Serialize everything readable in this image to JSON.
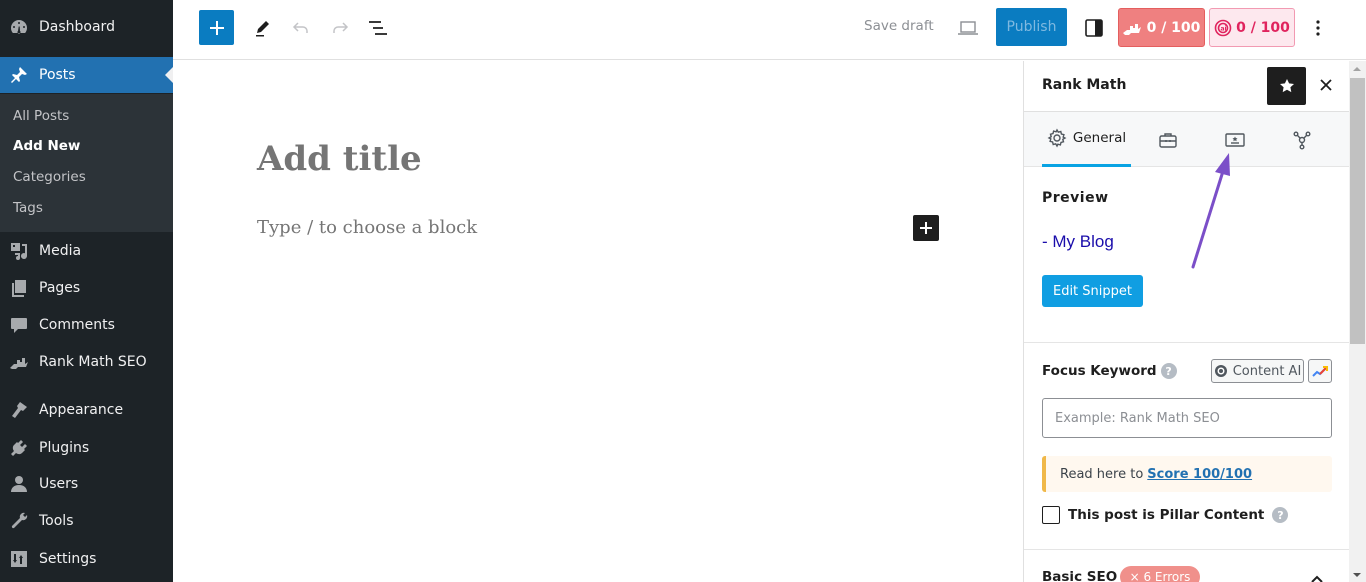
{
  "sidebar": {
    "items": [
      {
        "id": "dashboard",
        "label": "Dashboard",
        "icon": "dashboard-icon"
      },
      {
        "id": "posts",
        "label": "Posts",
        "icon": "pin-icon",
        "active": true
      },
      {
        "id": "media",
        "label": "Media",
        "icon": "media-icon"
      },
      {
        "id": "pages",
        "label": "Pages",
        "icon": "pages-icon"
      },
      {
        "id": "comments",
        "label": "Comments",
        "icon": "comment-icon"
      },
      {
        "id": "rank-math-seo",
        "label": "Rank Math SEO",
        "icon": "rank-math-icon"
      },
      {
        "id": "appearance",
        "label": "Appearance",
        "icon": "brush-icon"
      },
      {
        "id": "plugins",
        "label": "Plugins",
        "icon": "plug-icon"
      },
      {
        "id": "users",
        "label": "Users",
        "icon": "user-icon"
      },
      {
        "id": "tools",
        "label": "Tools",
        "icon": "wrench-icon"
      },
      {
        "id": "settings",
        "label": "Settings",
        "icon": "settings-icon"
      }
    ],
    "submenu": [
      {
        "label": "All Posts"
      },
      {
        "label": "Add New",
        "current": true
      },
      {
        "label": "Categories"
      },
      {
        "label": "Tags"
      }
    ]
  },
  "toolbar": {
    "save_draft": "Save draft",
    "publish": "Publish",
    "seo_score": "0 / 100",
    "content_ai_score": "0 / 100"
  },
  "editor": {
    "title_placeholder": "Add title",
    "block_placeholder": "Type / to choose a block"
  },
  "panel": {
    "title": "Rank Math",
    "tabs": [
      {
        "label": "General",
        "icon": "gear-icon",
        "active": true
      },
      {
        "label": "",
        "icon": "toolbox-icon"
      },
      {
        "label": "",
        "icon": "schema-certificate-icon"
      },
      {
        "label": "",
        "icon": "social-graph-icon"
      }
    ],
    "preview": {
      "label": "Preview",
      "link_text": "- My Blog",
      "edit_snippet": "Edit Snippet"
    },
    "focus_keyword": {
      "label": "Focus Keyword",
      "help": "?",
      "content_ai_button": "Content AI",
      "input_value": "",
      "input_placeholder": "Example: Rank Math SEO"
    },
    "notice": {
      "text": "Read here to",
      "link": "Score 100/100"
    },
    "pillar": {
      "label": "This post is Pillar Content",
      "checked": false,
      "help": "?"
    },
    "basic_seo": {
      "label": "Basic SEO",
      "errors_badge": "× 6 Errors"
    }
  },
  "colors": {
    "sidebar_bg": "#1d2327",
    "active_menu": "#2271b1",
    "primary_button": "#0a7cc1",
    "seo_score_bg": "#ef8080",
    "content_ai_accent": "#e0245e",
    "tab_active": "#09a3e3",
    "annotation_arrow": "#7b4fc8"
  }
}
